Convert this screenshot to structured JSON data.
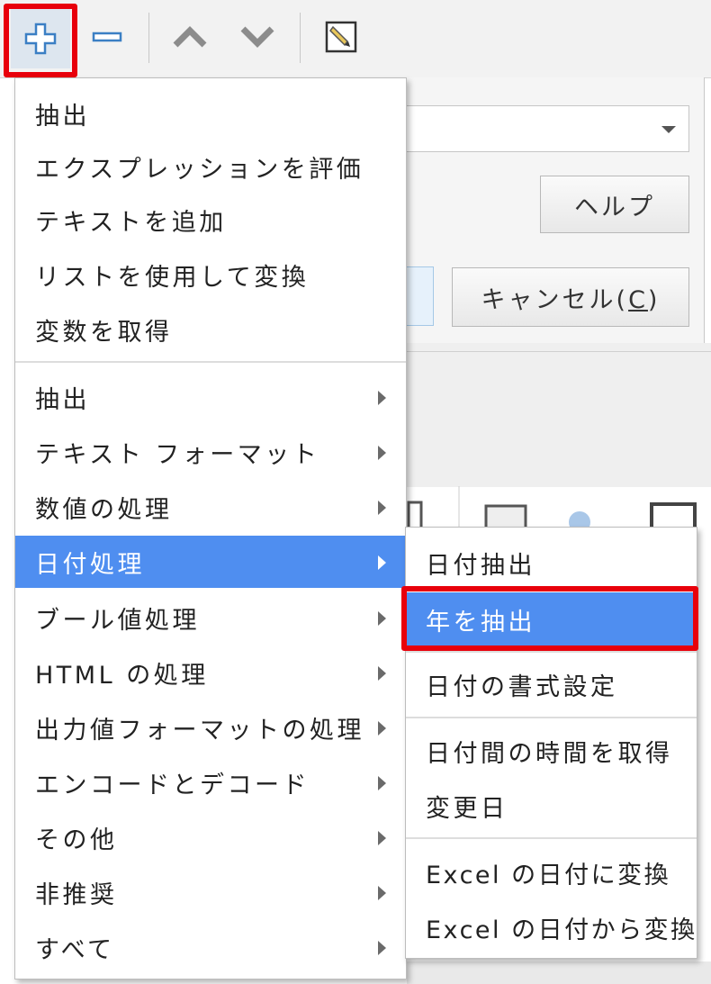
{
  "toolbar": {
    "buttons": [
      {
        "icon": "plus-icon",
        "active": true
      },
      {
        "icon": "minus-icon"
      },
      {
        "icon": "chevron-up-icon"
      },
      {
        "icon": "chevron-down-icon"
      },
      {
        "icon": "edit-icon"
      }
    ]
  },
  "dialog": {
    "dropdown_value": "",
    "help_button": "ヘルプ",
    "cancel_button": "キャンセル(C)",
    "cancel_mnemonic": "C"
  },
  "menu": {
    "group1": [
      "抽出",
      "エクスプレッションを評価",
      "テキストを追加",
      "リストを使用して変換",
      "変数を取得"
    ],
    "group2": [
      "抽出",
      "テキスト フォーマット",
      "数値の処理",
      "日付処理",
      "ブール値処理",
      "HTML の処理",
      "出力値フォーマットの処理",
      "エンコードとデコード",
      "その他",
      "非推奨",
      "すべて"
    ],
    "active_item": "日付処理"
  },
  "submenu": {
    "group1": [
      "日付抽出",
      "年を抽出"
    ],
    "group2": [
      "日付の書式設定"
    ],
    "group3": [
      "日付間の時間を取得",
      "変更日"
    ],
    "group4": [
      "Excel の日付に変換",
      "Excel の日付から変換"
    ],
    "active_item": "年を抽出"
  },
  "colors": {
    "highlight": "#e8000b",
    "menu_active": "#4f8ef0"
  }
}
